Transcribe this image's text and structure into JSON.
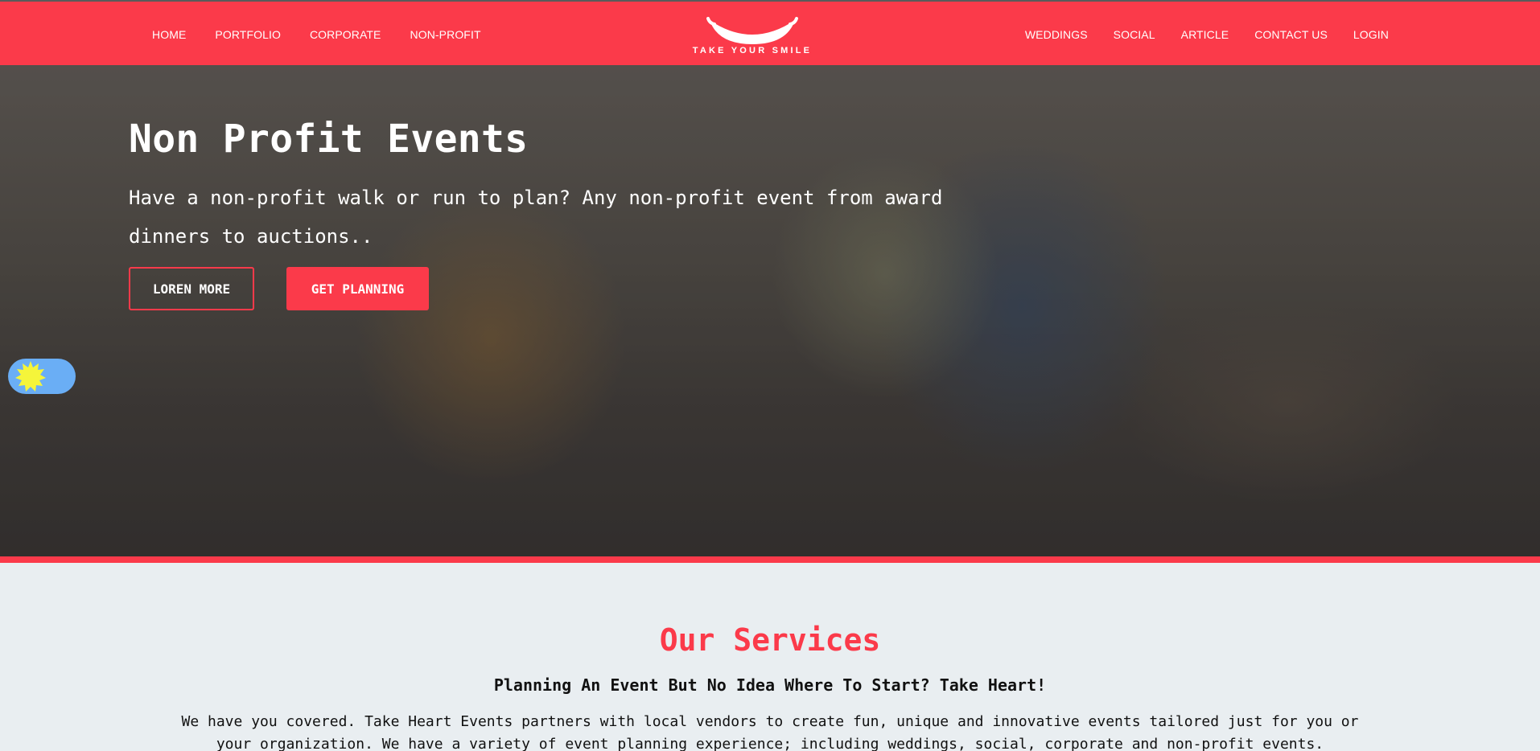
{
  "nav": {
    "left": [
      "HOME",
      "PORTFOLIO",
      "CORPORATE",
      "NON-PROFIT"
    ],
    "right": [
      "WEDDINGS",
      "SOCIAL",
      "ARTICLE",
      "CONTACT US",
      "LOGIN"
    ],
    "logo_text": "TAKE YOUR SMILE"
  },
  "hero": {
    "title": "Non Profit Events",
    "text": "Have a non-profit walk or run to plan? Any non-profit event from award dinners to auctions..",
    "button_more": "LOREN MORE",
    "button_plan": "GET PLANNING"
  },
  "services": {
    "title": "Our Services",
    "subtitle": "Planning An Event But No Idea Where To Start? Take Heart!",
    "text": "We have you covered. Take Heart Events partners with local vendors to create fun, unique and innovative events tailored just for you or your organization. We have a variety of event planning experience; including weddings, social, corporate and non-profit events."
  },
  "colors": {
    "brand": "#fb3a4a",
    "toggle": "#6aaef5",
    "sun": "#f5f53a",
    "page_bg": "#e9eef1"
  },
  "icons": {
    "logo": "smile-logo-icon",
    "theme_toggle": "sun-icon"
  }
}
